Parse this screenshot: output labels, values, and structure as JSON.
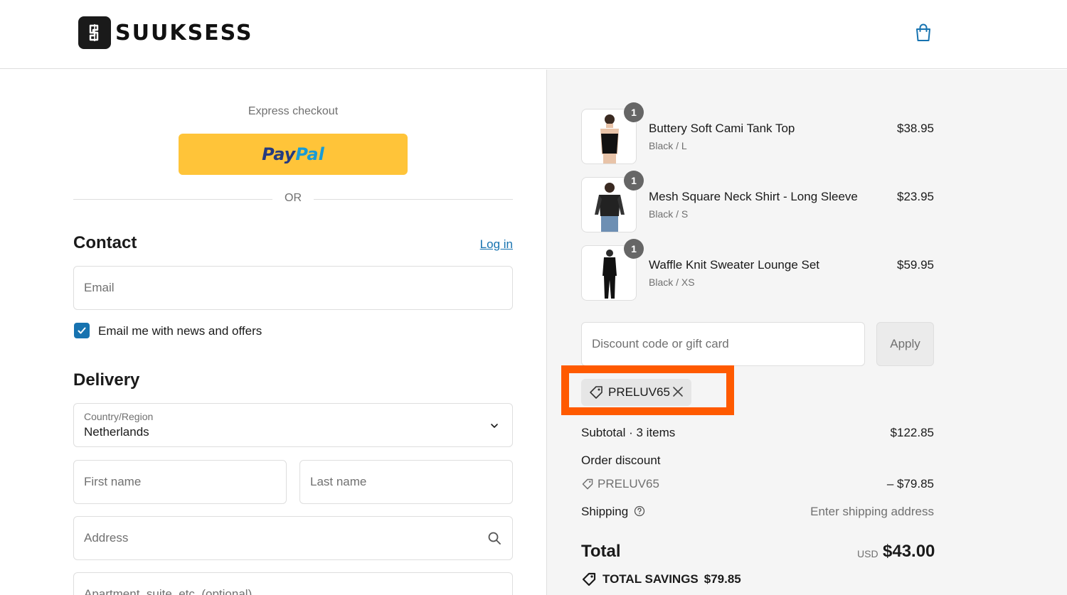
{
  "header": {
    "brand": "SUUKSESS",
    "cart_icon": "shopping-bag-icon"
  },
  "express": {
    "label": "Express checkout",
    "paypal_pay": "Pay",
    "paypal_pal": "Pal",
    "or": "OR"
  },
  "contact": {
    "title": "Contact",
    "login": "Log in",
    "email_placeholder": "Email",
    "newsletter_label": "Email me with news and offers",
    "newsletter_checked": true
  },
  "delivery": {
    "title": "Delivery",
    "country_label": "Country/Region",
    "country_value": "Netherlands",
    "first_name_placeholder": "First name",
    "last_name_placeholder": "Last name",
    "address_placeholder": "Address",
    "apartment_placeholder": "Apartment, suite, etc. (optional)"
  },
  "cart": {
    "items": [
      {
        "name": "Buttery Soft Cami Tank Top",
        "variant": "Black / L",
        "price": "$38.95",
        "qty": "1"
      },
      {
        "name": "Mesh Square Neck Shirt - Long Sleeve",
        "variant": "Black / S",
        "price": "$23.95",
        "qty": "1"
      },
      {
        "name": "Waffle Knit Sweater Lounge Set",
        "variant": "Black / XS",
        "price": "$59.95",
        "qty": "1"
      }
    ]
  },
  "discount": {
    "placeholder": "Discount code or gift card",
    "apply": "Apply",
    "applied_code": "PRELUV65"
  },
  "summary": {
    "subtotal_label": "Subtotal · 3 items",
    "subtotal_value": "$122.85",
    "order_discount_label": "Order discount",
    "discount_code": "PRELUV65",
    "discount_value": "– $79.85",
    "shipping_label": "Shipping",
    "shipping_value": "Enter shipping address",
    "total_label": "Total",
    "currency": "USD",
    "total_value": "$43.00",
    "savings_label": "TOTAL SAVINGS",
    "savings_value": "$79.85"
  },
  "colors": {
    "accent": "#1773b0",
    "paypal_yellow": "#ffc439",
    "highlight": "#ff5a00"
  }
}
